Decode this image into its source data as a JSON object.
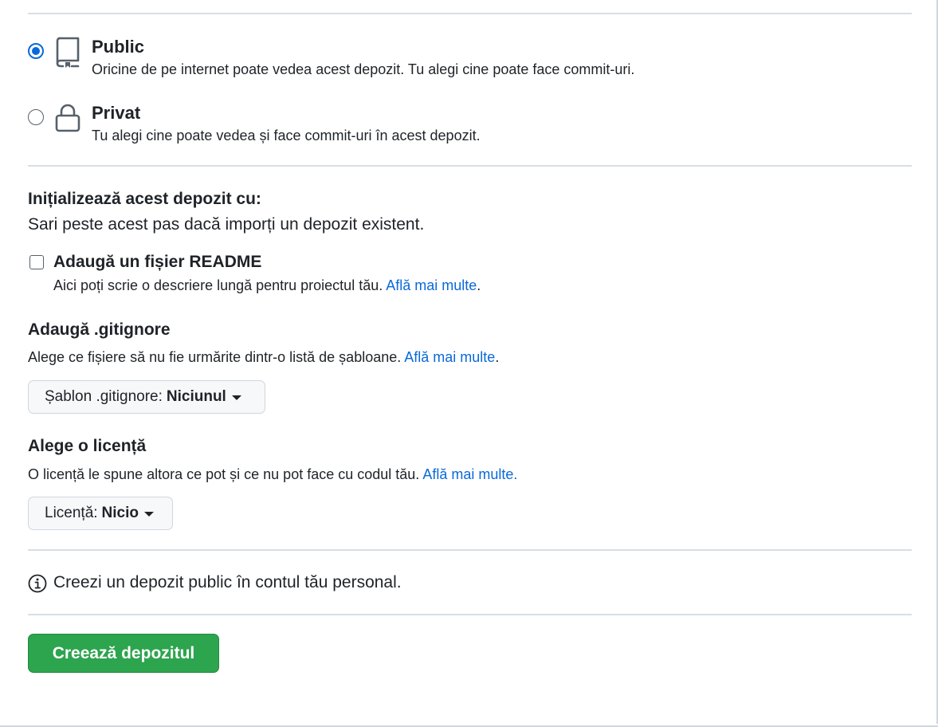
{
  "visibility": {
    "public": {
      "title": "Public",
      "description": "Oricine de pe internet poate vedea acest depozit. Tu alegi cine poate face commit-uri.",
      "selected": true
    },
    "private": {
      "title": "Privat",
      "description": "Tu alegi cine poate vedea și face commit-uri în acest depozit.",
      "selected": false
    }
  },
  "initialize": {
    "title": "Inițializează acest depozit cu:",
    "subtitle": "Sari peste acest pas dacă imporți un depozit existent.",
    "readme": {
      "label": "Adaugă un fișier README",
      "description": "Aici poți scrie o descriere lungă pentru proiectul tău.",
      "link": "Află mai multe",
      "trailing": ".",
      "checked": false
    }
  },
  "gitignore": {
    "title": "Adaugă .gitignore",
    "description": "Alege ce fișiere să nu fie urmărite dintr-o listă de șabloane.",
    "link": "Află mai multe",
    "trailing": ".",
    "dropdown_label": "Șablon .gitignore:",
    "dropdown_value": "Niciunul"
  },
  "license": {
    "title": "Alege o licență",
    "description": "O licență le spune altora ce pot și ce nu pot face cu codul tău.",
    "link": "Află mai multe.",
    "dropdown_label": "Licență:",
    "dropdown_value": "Nicio"
  },
  "info": {
    "text": "Creezi un depozit public în contul tău personal.",
    "icon": "info-icon"
  },
  "submit": {
    "label": "Creează depozitul"
  },
  "colors": {
    "accent": "#0969da",
    "button_green": "#2da44e",
    "text": "#1f2328",
    "border": "#d0d7de"
  }
}
